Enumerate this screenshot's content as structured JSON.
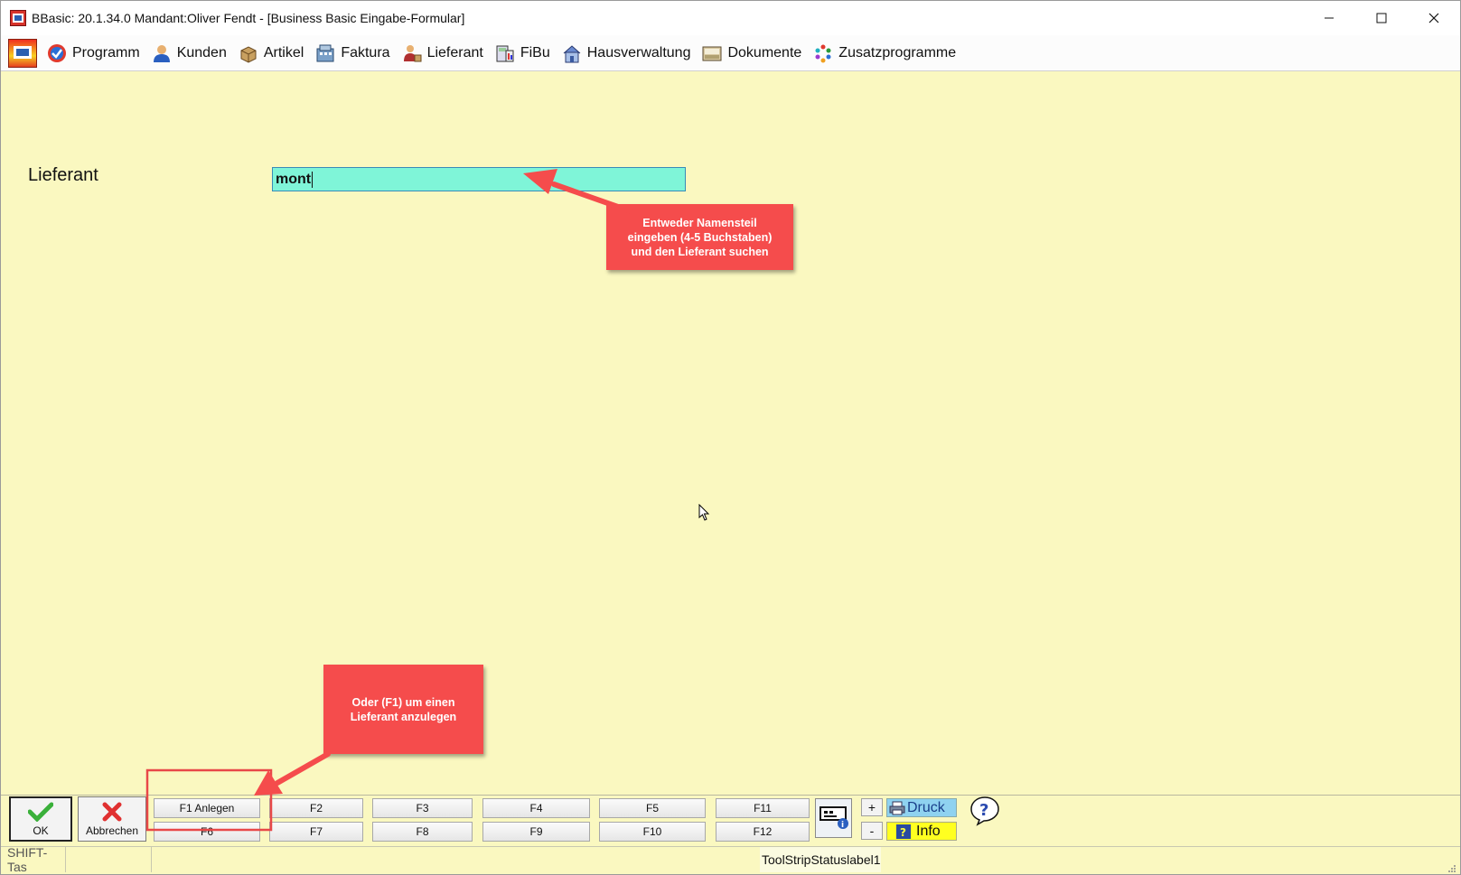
{
  "window": {
    "title": "BBasic: 20.1.34.0 Mandant:Oliver Fendt  - [Business Basic Eingabe-Formular]"
  },
  "menu": {
    "items": [
      {
        "label": "Programm",
        "icon": "programm-icon"
      },
      {
        "label": "Kunden",
        "icon": "kunden-icon"
      },
      {
        "label": "Artikel",
        "icon": "artikel-icon"
      },
      {
        "label": "Faktura",
        "icon": "faktura-icon"
      },
      {
        "label": "Lieferant",
        "icon": "lieferant-icon"
      },
      {
        "label": "FiBu",
        "icon": "fibu-icon"
      },
      {
        "label": "Hausverwaltung",
        "icon": "hausverwaltung-icon"
      },
      {
        "label": "Dokumente",
        "icon": "dokumente-icon"
      },
      {
        "label": "Zusatzprogramme",
        "icon": "zusatzprogramme-icon"
      }
    ]
  },
  "form": {
    "field_label": "Lieferant",
    "field_value": "mont"
  },
  "callouts": {
    "search_hint": "Entweder Namensteil eingeben (4-5 Buchstaben) und den Lieferant suchen",
    "create_hint": "Oder (F1) um einen Lieferant anzulegen"
  },
  "buttons": {
    "ok": "OK",
    "cancel": "Abbrechen",
    "f1": "F1 Anlegen",
    "f2": "F2",
    "f3": "F3",
    "f4": "F4",
    "f5": "F5",
    "f6": "F6",
    "f7": "F7",
    "f8": "F8",
    "f9": "F9",
    "f10": "F10",
    "f11": "F11",
    "f12": "F12",
    "plus": "+",
    "minus": "-",
    "druck": "Druck",
    "info": "Info"
  },
  "status": {
    "shift": "SHIFT-Tas",
    "label": "ToolStripStatuslabel1"
  },
  "colors": {
    "form_bg": "#faf8c0",
    "input_bg": "#7ff5d8",
    "callout_bg": "#f54c4c",
    "highlight_box": "#e84848",
    "druck_bg": "#8fd2f0",
    "info_bg": "#ffff20"
  }
}
